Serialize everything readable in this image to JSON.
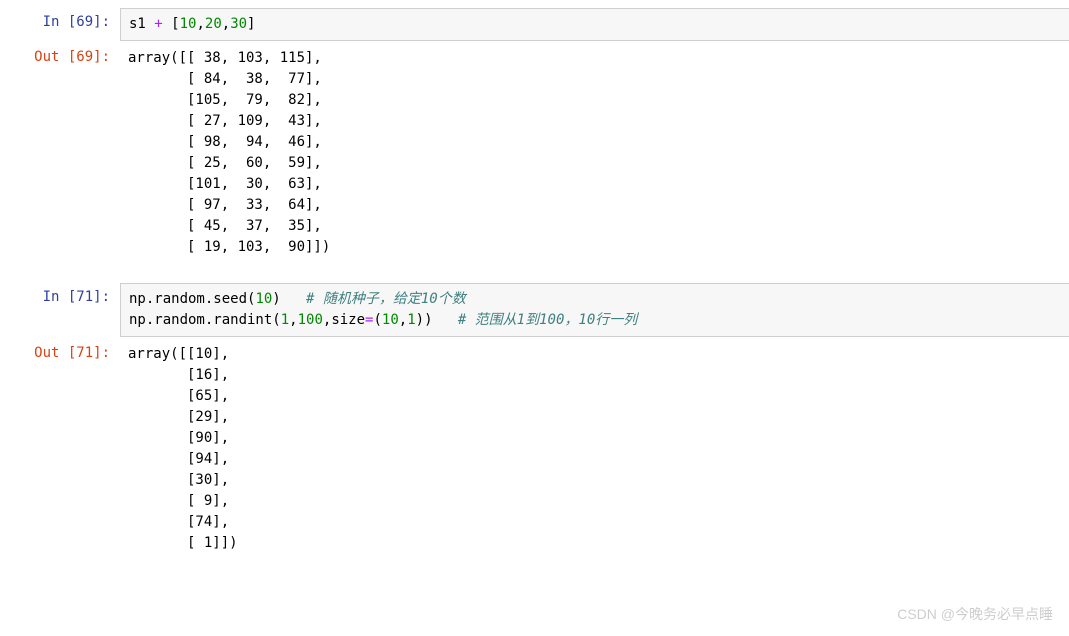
{
  "cells": [
    {
      "prompt_type": "In",
      "prompt_num": "69",
      "kind": "input",
      "code_tokens": [
        [
          {
            "t": "s1 ",
            "c": "c-var"
          },
          {
            "t": "+",
            "c": "c-op"
          },
          {
            "t": " [",
            "c": "c-punct"
          },
          {
            "t": "10",
            "c": "c-num"
          },
          {
            "t": ",",
            "c": "c-punct"
          },
          {
            "t": "20",
            "c": "c-num"
          },
          {
            "t": ",",
            "c": "c-punct"
          },
          {
            "t": "30",
            "c": "c-num"
          },
          {
            "t": "]",
            "c": "c-punct"
          }
        ]
      ]
    },
    {
      "prompt_type": "Out",
      "prompt_num": "69",
      "kind": "output",
      "text": "array([[ 38, 103, 115],\n       [ 84,  38,  77],\n       [105,  79,  82],\n       [ 27, 109,  43],\n       [ 98,  94,  46],\n       [ 25,  60,  59],\n       [101,  30,  63],\n       [ 97,  33,  64],\n       [ 45,  37,  35],\n       [ 19, 103,  90]])"
    },
    {
      "prompt_type": "In",
      "prompt_num": "71",
      "kind": "input",
      "code_tokens": [
        [
          {
            "t": "np.random.seed(",
            "c": "c-var"
          },
          {
            "t": "10",
            "c": "c-num"
          },
          {
            "t": ")   ",
            "c": "c-punct"
          },
          {
            "t": "# 随机种子，给定10个数",
            "c": "c-comment"
          }
        ],
        [
          {
            "t": "np.random.randint(",
            "c": "c-var"
          },
          {
            "t": "1",
            "c": "c-num"
          },
          {
            "t": ",",
            "c": "c-punct"
          },
          {
            "t": "100",
            "c": "c-num"
          },
          {
            "t": ",size",
            "c": "c-var"
          },
          {
            "t": "=",
            "c": "c-op"
          },
          {
            "t": "(",
            "c": "c-punct"
          },
          {
            "t": "10",
            "c": "c-num"
          },
          {
            "t": ",",
            "c": "c-punct"
          },
          {
            "t": "1",
            "c": "c-num"
          },
          {
            "t": "))   ",
            "c": "c-punct"
          },
          {
            "t": "# 范围从1到100，10行一列",
            "c": "c-comment"
          }
        ]
      ]
    },
    {
      "prompt_type": "Out",
      "prompt_num": "71",
      "kind": "output",
      "text": "array([[10],\n       [16],\n       [65],\n       [29],\n       [90],\n       [94],\n       [30],\n       [ 9],\n       [74],\n       [ 1]])"
    }
  ],
  "watermark": "CSDN @今晚务必早点睡"
}
